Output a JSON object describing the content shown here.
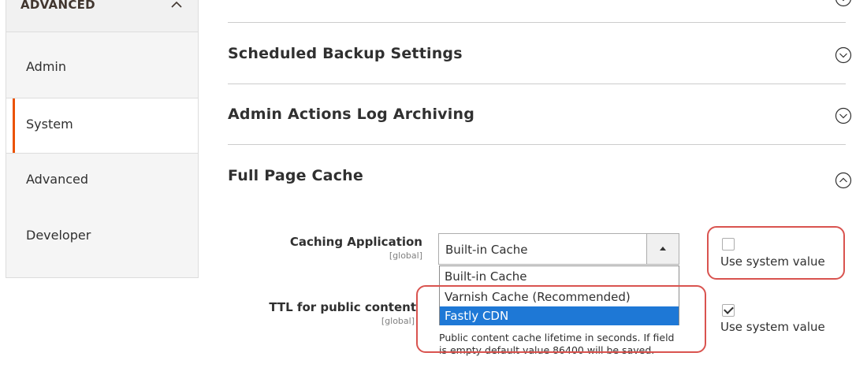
{
  "sidebar": {
    "title": "ADVANCED",
    "items": [
      {
        "label": "Admin"
      },
      {
        "label": "System"
      },
      {
        "label": "Advanced"
      },
      {
        "label": "Developer"
      }
    ]
  },
  "sections": [
    {
      "title": "Scheduled Backup Settings",
      "expanded": false
    },
    {
      "title": "Admin Actions Log Archiving",
      "expanded": false
    },
    {
      "title": "Full Page Cache",
      "expanded": true
    }
  ],
  "fields": {
    "caching_application": {
      "label": "Caching Application",
      "scope": "[global]",
      "value": "Built-in Cache",
      "options": [
        "Built-in Cache",
        "Varnish Cache (Recommended)",
        "Fastly CDN"
      ],
      "highlighted_option": "Fastly CDN",
      "use_system_value_label": "Use system value",
      "use_system_value_checked": false
    },
    "ttl_public_content": {
      "label": "TTL for public content",
      "scope": "[global]",
      "note": "Public content cache lifetime in seconds. If field is empty default value 86400 will be saved.",
      "use_system_value_label": "Use system value",
      "use_system_value_checked": true
    }
  },
  "colors": {
    "accent": "#eb5202",
    "selection": "#1e78d6",
    "highlight_ring": "#d9534f"
  }
}
